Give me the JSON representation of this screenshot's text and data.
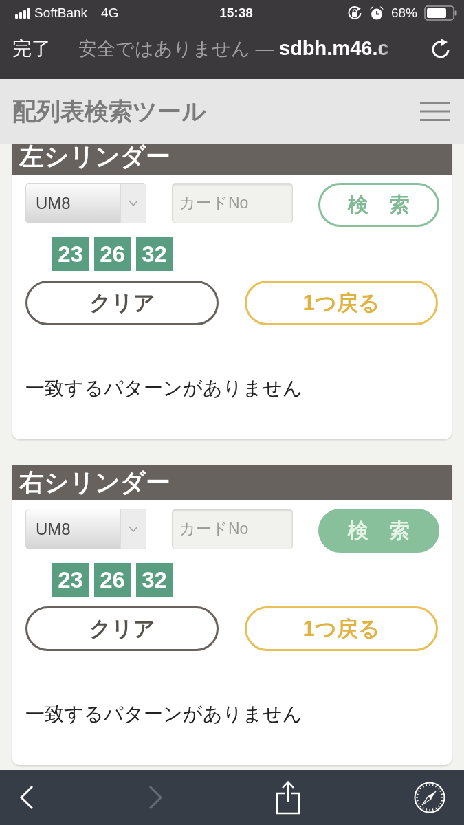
{
  "status_bar": {
    "carrier": "SoftBank",
    "network": "4G",
    "time": "15:38",
    "battery": "68%"
  },
  "browser_bar": {
    "done": "完了",
    "address": "安全ではありません — **sdbh.m46.c**"
  },
  "header": {
    "title": "配列表検索ツール"
  },
  "cylinders": [
    {
      "title": "左シリンダー",
      "select": {
        "value": "UM8"
      },
      "card_no": {
        "placeholder": "カードNo"
      },
      "search": {
        "label": "検　索",
        "pressed": false
      },
      "numbers": [
        "23",
        "26",
        "32"
      ],
      "clear": "クリア",
      "back": "1つ戻る",
      "result": "一致するパターンがありません"
    },
    {
      "title": "右シリンダー",
      "select": {
        "value": "UM8"
      },
      "card_no": {
        "placeholder": "カードNo"
      },
      "search": {
        "label": "検　索",
        "pressed": true
      },
      "numbers": [
        "23",
        "26",
        "32"
      ],
      "clear": "クリア",
      "back": "1つ戻る",
      "result": "一致するパターンがありません"
    }
  ],
  "toolbar": {
    "items": [
      {
        "kind": "back",
        "disabled": false
      },
      {
        "kind": "forward",
        "disabled": true
      },
      {
        "kind": "share"
      },
      {
        "kind": "compass"
      }
    ]
  }
}
